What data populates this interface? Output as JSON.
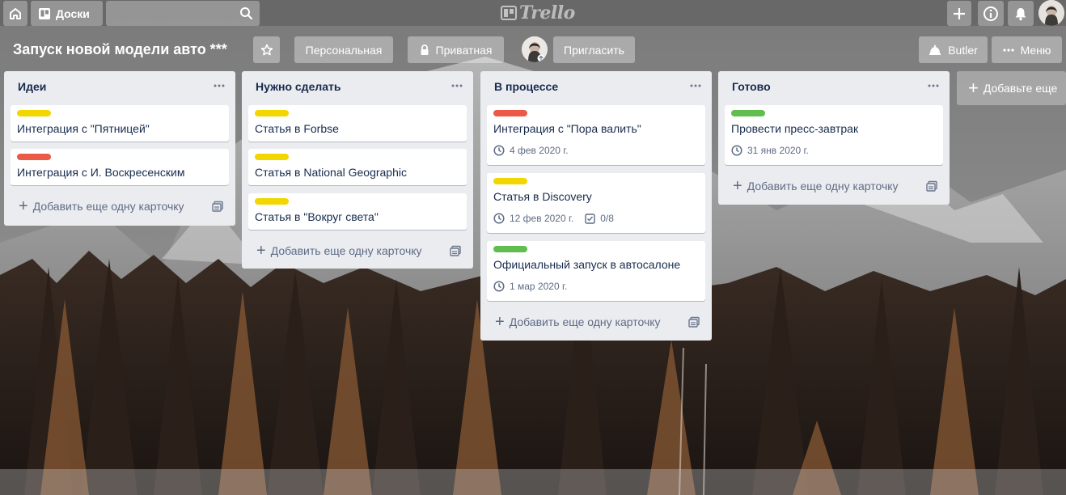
{
  "header": {
    "home_icon": "home-icon",
    "boards_label": "Доски",
    "search": {
      "value": "",
      "placeholder": ""
    },
    "logo_text": "Trello",
    "actions": [
      "plus-icon",
      "info-icon",
      "bell-icon"
    ]
  },
  "board": {
    "title": "Запуск новой модели авто ***",
    "team_label": "Персональная",
    "visibility_label": "Приватная",
    "invite_label": "Пригласить",
    "butler_label": "Butler",
    "menu_label": "Меню"
  },
  "colors": {
    "yellow": "#f2d600",
    "red": "#eb5a46",
    "green": "#61bd4f",
    "list_bg": "#ebecf0",
    "muted_text": "#5e6c84",
    "text": "#172b4d"
  },
  "lists": [
    {
      "title": "Идеи",
      "add_label": "Добавить еще одну карточку",
      "cards": [
        {
          "label_color": "yellow",
          "title": "Интеграция с \"Пятницей\""
        },
        {
          "label_color": "red",
          "title": "Интеграция с И. Воскресенским"
        }
      ]
    },
    {
      "title": "Нужно сделать",
      "add_label": "Добавить еще одну карточку",
      "cards": [
        {
          "label_color": "yellow",
          "title": "Статья в Forbse"
        },
        {
          "label_color": "yellow",
          "title": "Статья в National Geographic"
        },
        {
          "label_color": "yellow",
          "title": "Статья в \"Вокруг света\""
        }
      ]
    },
    {
      "title": "В процессе",
      "add_label": "Добавить еще одну карточку",
      "cards": [
        {
          "label_color": "red",
          "title": "Интеграция с \"Пора валить\"",
          "due": "4 фев 2020 г."
        },
        {
          "label_color": "yellow",
          "title": "Статья в Discovery",
          "due": "12 фев 2020 г.",
          "checklist": "0/8"
        },
        {
          "label_color": "green",
          "title": "Официальный запуск в автосалоне",
          "due": "1 мар 2020 г."
        }
      ]
    },
    {
      "title": "Готово",
      "add_label": "Добавить еще одну карточку",
      "cards": [
        {
          "label_color": "green",
          "title": "Провести пресс-завтрак",
          "due": "31 янв 2020 г."
        }
      ]
    }
  ],
  "add_list_label": "Добавьте еще"
}
